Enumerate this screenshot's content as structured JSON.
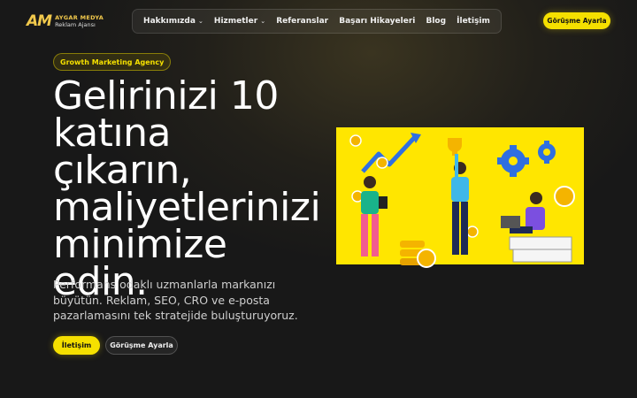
{
  "brand": {
    "mark": "AM",
    "name": "AYGAR MEDYA",
    "tagline": "Reklam Ajansı"
  },
  "nav": {
    "items": [
      {
        "label": "Hakkımızda",
        "dropdown": true
      },
      {
        "label": "Hizmetler",
        "dropdown": true
      },
      {
        "label": "Referanslar",
        "dropdown": false
      },
      {
        "label": "Başarı Hikayeleri",
        "dropdown": false
      },
      {
        "label": "Blog",
        "dropdown": false
      },
      {
        "label": "İletişim",
        "dropdown": false
      }
    ],
    "cta_label": "Görüşme Ayarla"
  },
  "hero": {
    "badge": "Growth Marketing Agency",
    "headline_lines": [
      "Gelirinizi 10",
      "katına çıkarın,",
      "maliyetlerinizi",
      "minimize",
      "edin."
    ],
    "subtitle": "Performans odaklı uzmanlarla markanızı büyütün. Reklam, SEO, CRO ve e-posta pazarlamasını tek stratejide buluşturuyoruz.",
    "primary_button": "İletişim",
    "secondary_button": "Görüşme Ayarla"
  },
  "colors": {
    "accent": "#f5e000",
    "background": "#181818",
    "illustration_bg": "#ffe600"
  },
  "icons": {
    "chevron": "chevron-down-icon"
  }
}
